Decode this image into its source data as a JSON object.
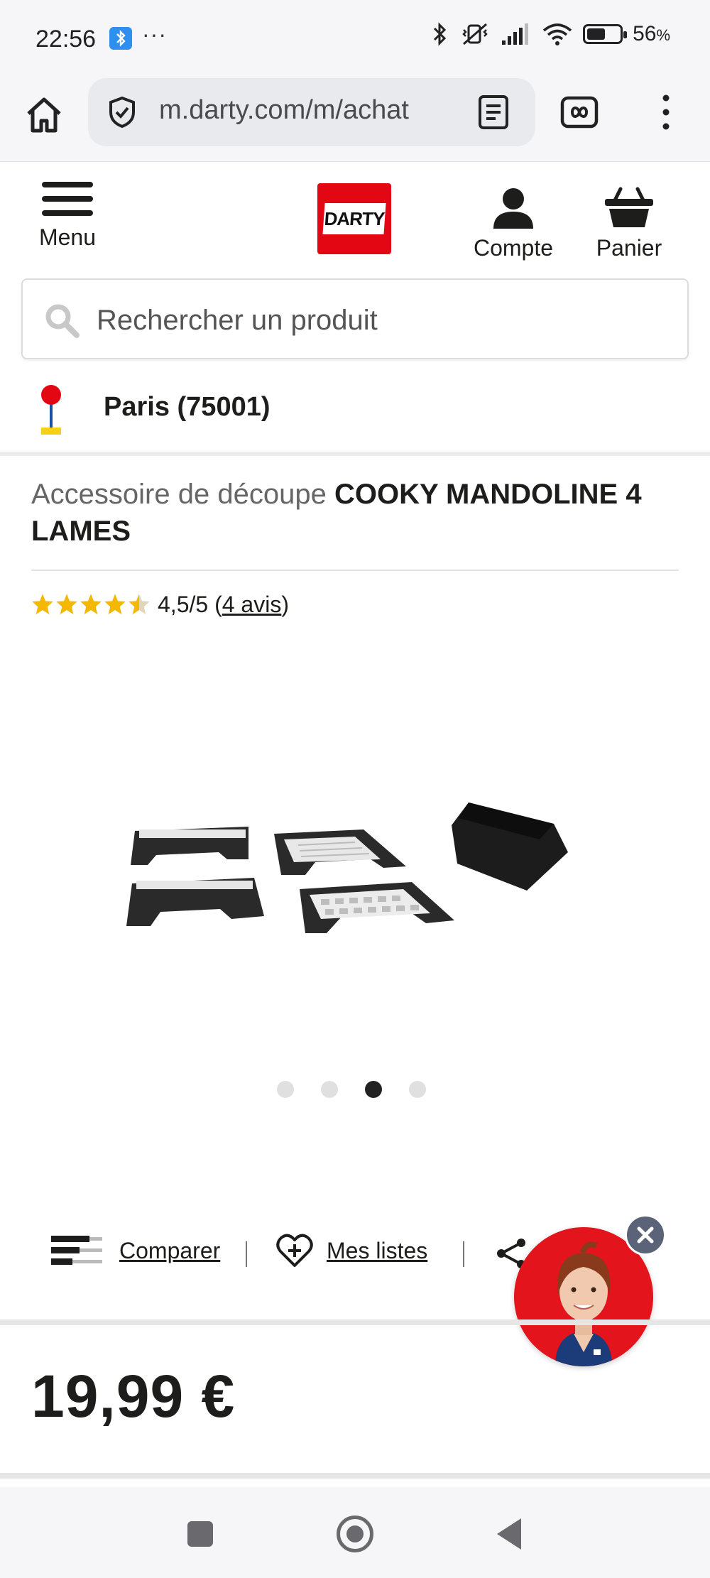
{
  "status_bar": {
    "time": "22:56",
    "dots": "···",
    "battery_percent": "56",
    "battery_unit": "%",
    "battery_level": 0.56,
    "icons": [
      "bluetooth-app-icon",
      "bluetooth-icon",
      "mute-vibrate-icon",
      "signal-icon",
      "wifi-icon",
      "battery-icon"
    ]
  },
  "browser": {
    "url": "m.darty.com/m/achat",
    "icons": [
      "home-icon",
      "shield-icon",
      "reader-mode-icon",
      "tabs-icon",
      "more-vert-icon"
    ]
  },
  "header": {
    "menu_label": "Menu",
    "logo_text": "DARTY",
    "account_label": "Compte",
    "cart_label": "Panier",
    "brand_color": "#e30613"
  },
  "search": {
    "placeholder": "Rechercher un produit"
  },
  "location": {
    "city": "Paris (75001)"
  },
  "product": {
    "category": "Accessoire de découpe",
    "name": "COOKY MANDOLINE 4 LAMES",
    "rating_value": 4.5,
    "rating_text": "4,5/5",
    "reviews_prefix": "(",
    "reviews_link": "4 avis",
    "reviews_suffix": ")",
    "price": "19,99 €",
    "carousel_total": 4,
    "carousel_active": 3
  },
  "actions": {
    "compare_label": "Comparer",
    "lists_label": "Mes listes"
  },
  "colors": {
    "star": "#f5b800",
    "accent_red": "#e3141c"
  }
}
